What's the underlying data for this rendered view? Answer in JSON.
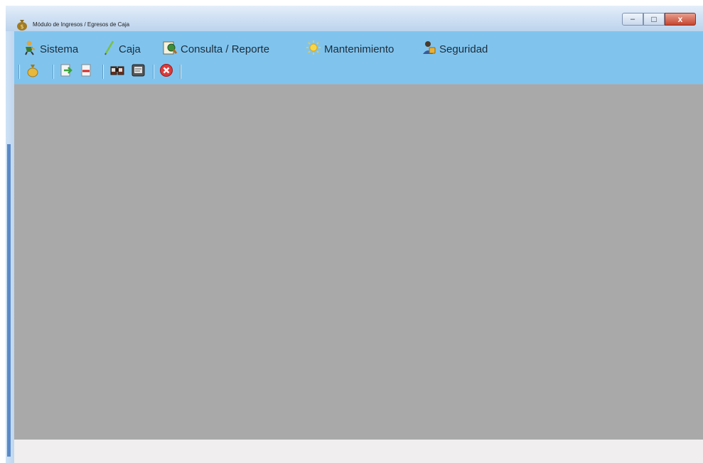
{
  "window": {
    "title": "Módulo de Ingresos / Egresos de Caja",
    "controls": {
      "minimize": "–",
      "maximize": "□",
      "close": "x"
    }
  },
  "menu": [
    {
      "label": "Sistema",
      "icon": "person-icon"
    },
    {
      "label": "Caja",
      "icon": "pen-icon"
    },
    {
      "label": "Consulta / Reporte",
      "icon": "search-user-icon"
    },
    {
      "label": "Mantenimiento",
      "icon": "sun-gear-icon"
    },
    {
      "label": "Seguridad",
      "icon": "security-user-icon"
    }
  ],
  "toolbar": [
    {
      "icon": "money-bag-icon"
    },
    {
      "icon": "green-arrow-icon"
    },
    {
      "icon": "red-arrow-icon"
    },
    {
      "icon": "binoculars-icon"
    },
    {
      "icon": "document-icon"
    },
    {
      "icon": "exit-icon"
    }
  ],
  "colors": {
    "menubar": "#80c4ee",
    "workspace": "#a9a9a9",
    "statusbar": "#f0eeee"
  }
}
